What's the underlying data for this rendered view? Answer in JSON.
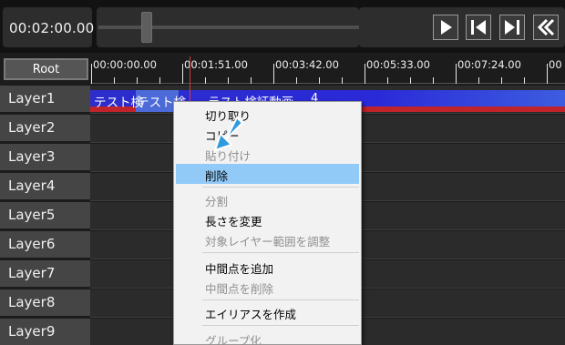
{
  "transport": {
    "time": "00:02:00.00",
    "buttons": [
      "play-icon",
      "step-back-icon",
      "step-forward-icon",
      "rewind-icon"
    ]
  },
  "timeline": {
    "root_label": "Root",
    "ruler_labels": [
      "00:00:00.00",
      "00:01:51.00",
      "00:03:42.00",
      "00:05:33.00",
      "00:07:24.00",
      "00"
    ]
  },
  "layers": [
    "Layer1",
    "Layer2",
    "Layer3",
    "Layer4",
    "Layer5",
    "Layer6",
    "Layer7",
    "Layer8",
    "Layer9"
  ],
  "clip": {
    "text_a": "テスト検",
    "text_b": "テスト検",
    "text_c": "ラスト検証動画",
    "marker": "4"
  },
  "context_menu": {
    "cut": "切り取り",
    "copy": "コピー",
    "paste": "貼り付け",
    "delete": "削除",
    "split": "分割",
    "change_length": "長さを変更",
    "adjust_range": "対象レイヤー範囲を調整",
    "add_midpoint": "中間点を追加",
    "remove_midpoint": "中間点を削除",
    "create_alias": "エイリアスを作成",
    "group": "グループ化"
  },
  "colors": {
    "clip_blue": "#2a2ad8",
    "clip_red": "#c0232a",
    "menu_highlight": "#91c9f7",
    "cursor": "#2f9bdf"
  }
}
